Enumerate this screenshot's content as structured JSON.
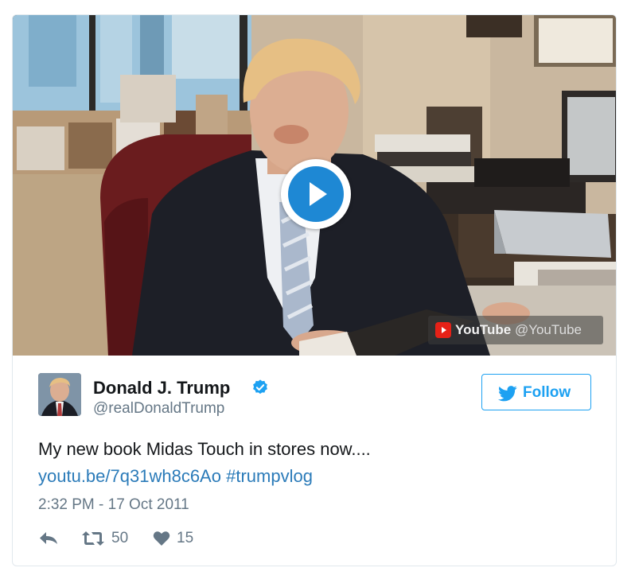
{
  "video": {
    "provider": "YouTube",
    "provider_handle": "@YouTube",
    "icon": "play-icon"
  },
  "author": {
    "name": "Donald J. Trump",
    "handle": "@realDonaldTrump",
    "verified": true,
    "avatar_icon": "avatar"
  },
  "follow_button": {
    "label": "Follow",
    "icon": "twitter-bird-icon"
  },
  "tweet": {
    "text": "My new book Midas Touch in stores now....",
    "link": "youtu.be/7q31wh8c6Ao",
    "hashtag": "#trumpvlog",
    "timestamp": "2:32 PM - 17 Oct 2011"
  },
  "actions": {
    "reply_icon": "reply-icon",
    "retweet_icon": "retweet-icon",
    "retweet_count": "50",
    "like_icon": "heart-icon",
    "like_count": "15"
  },
  "colors": {
    "accent": "#1da1f2",
    "link": "#2b7bb9",
    "play_button": "#1e88d4",
    "muted_text": "#657786",
    "border": "#e1e8ed"
  }
}
